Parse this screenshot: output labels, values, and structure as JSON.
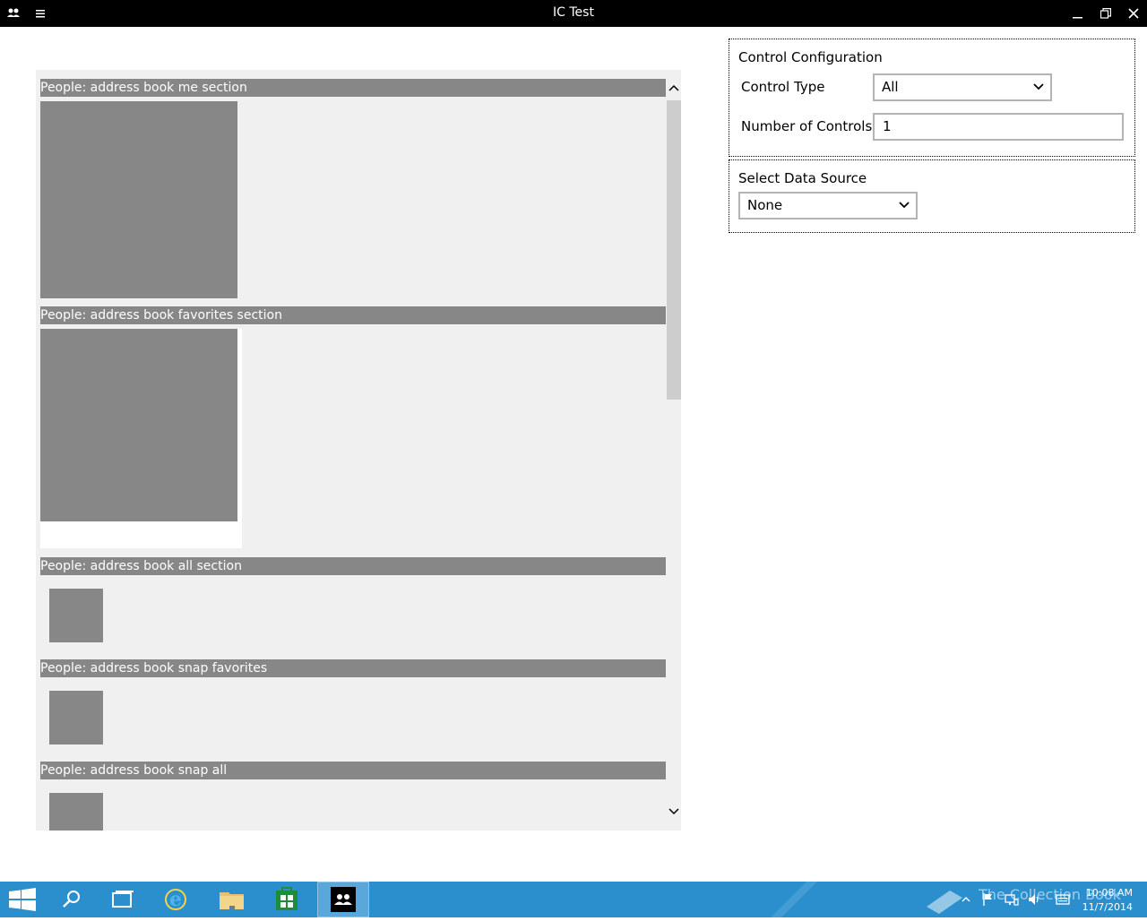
{
  "window": {
    "title": "IC Test"
  },
  "sections": [
    {
      "label": "People: address book me section"
    },
    {
      "label": "People: address book favorites section"
    },
    {
      "label": "People: address book all section"
    },
    {
      "label": "People: address book snap favorites"
    },
    {
      "label": "People: address book snap all"
    }
  ],
  "control_config": {
    "title": "Control Configuration",
    "control_type_label": "Control Type",
    "control_type_value": "All",
    "num_controls_label": "Number of Controls",
    "num_controls_value": "1"
  },
  "data_source": {
    "title": "Select Data Source",
    "value": "None"
  },
  "taskbar": {
    "time": "10:08 AM",
    "date": "11/7/2014",
    "watermark": "The Collection Book"
  },
  "colors": {
    "tile": "#878787",
    "taskbar": "#2b8fce",
    "titlebar": "#000000"
  }
}
